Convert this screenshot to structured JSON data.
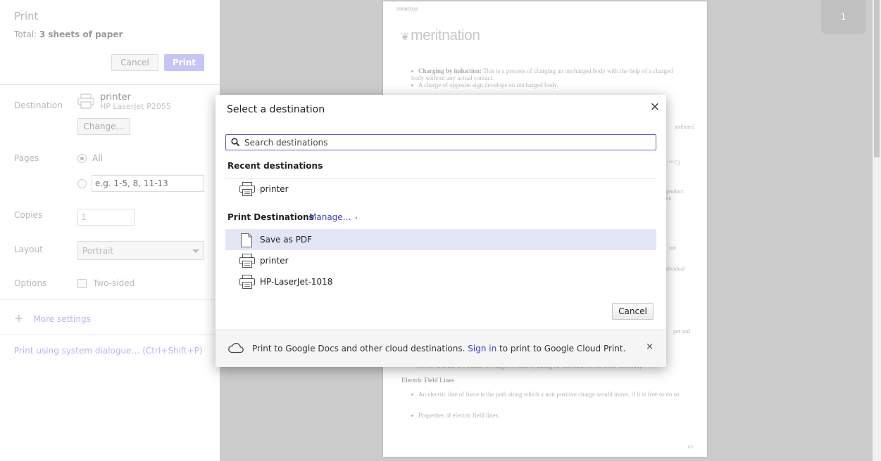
{
  "sidebar": {
    "title": "Print",
    "total_prefix": "Total: ",
    "total_value": "3 sheets of paper",
    "cancel_label": "Cancel",
    "print_label": "Print",
    "destination_label": "Destination",
    "destination_name": "printer",
    "destination_sub": "HP LaserJet P2055",
    "change_label": "Change…",
    "pages_label": "Pages",
    "pages_all_label": "All",
    "pages_placeholder": "e.g. 1-5, 8, 11-13",
    "copies_label": "Copies",
    "copies_value": "1",
    "layout_label": "Layout",
    "layout_value": "Portrait",
    "options_label": "Options",
    "two_sided_label": "Two-sided",
    "more_settings_label": "More settings",
    "system_dialog_label": "Print using system dialogue… (Ctrl+Shift+P)"
  },
  "preview": {
    "date": "20/08/2018",
    "logo": "meritnation",
    "bullet1_bold": "Charging by induction:",
    "bullet1_text": " This is a process of charging an uncharged body with the help of a charged body without any actual contact.",
    "bullet2": "A charge of opposite sign develops on uncharged body.",
    "peek_right_1": "stributed",
    "peek_right_2": "⁻¹⁹ C)",
    "peek_right_3": "product",
    "peek_right_4": "en",
    "peek_right_5": "not",
    "peek_right_6": "dividual",
    "peek_right_7": "per and",
    "peek_bottom_strike": "Electric field due to a number of charges is found by adding the individual electric fields vectorially",
    "heading": "Electric Field Lines",
    "bullet3": "An electric line of force is the path along which a unit positive charge would move, if it is free to do so.",
    "bullet4": "Properties of electric field lines",
    "page_number": "1/3",
    "zoom_page": "1"
  },
  "modal": {
    "title": "Select a destination",
    "close_glyph": "×",
    "search_placeholder": "Search destinations",
    "recent_heading": "Recent destinations",
    "recent_items": [
      {
        "label": "printer",
        "icon": "printer-icon"
      }
    ],
    "print_heading": "Print Destinations",
    "manage_label": "Manage…",
    "print_items": [
      {
        "label": "Save as PDF",
        "icon": "document-icon",
        "selected": true
      },
      {
        "label": "printer",
        "icon": "printer-icon",
        "selected": false
      },
      {
        "label": "HP-LaserJet-1018",
        "icon": "printer-icon",
        "selected": false
      }
    ],
    "cancel_label": "Cancel",
    "footer_text_before": "Print to Google Docs and other cloud destinations. ",
    "footer_link": "Sign in",
    "footer_text_after": " to print to Google Cloud Print.",
    "footer_close_glyph": "×"
  },
  "colors": {
    "accent": "#3c3ccf",
    "selected_row": "#e3e6f6",
    "preview_bg": "#cccccc"
  }
}
